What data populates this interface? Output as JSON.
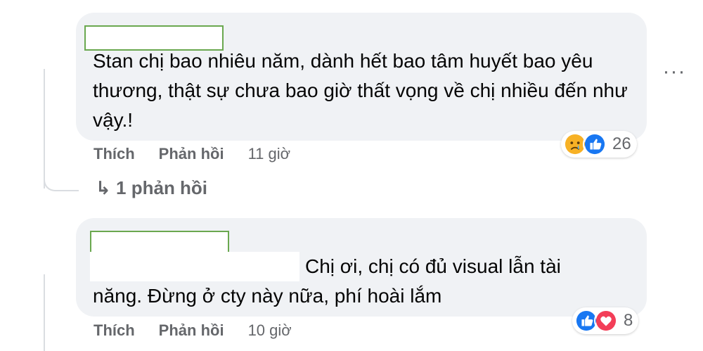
{
  "comments": [
    {
      "text": "Stan chị bao nhiêu năm, dành hết bao tâm huyết bao yêu thương, thật sự chưa bao giờ thất vọng về chị nhiều đến như vậy.!",
      "like_label": "Thích",
      "reply_label": "Phản hồi",
      "time": "11 giờ",
      "reactions": {
        "icons": [
          "sad-icon",
          "like-icon"
        ],
        "count": "26"
      },
      "replies_link": "1 phản hồi"
    },
    {
      "text_line1": "Chị ơi, chị có đủ visual lẫn tài",
      "text_line2": "năng. Đừng ở cty này nữa, phí hoài lắm",
      "like_label": "Thích",
      "reply_label": "Phản hồi",
      "time": "10 giờ",
      "reactions": {
        "icons": [
          "like-icon",
          "love-icon"
        ],
        "count": "8"
      }
    }
  ],
  "more_label": "···",
  "reply_arrow": "↳",
  "colors": {
    "bubble": "#f0f2f5",
    "secondary_text": "#65676b",
    "like_blue": "#1877f2",
    "love_red": "#f33e58",
    "sad_yellow": "#f7b125",
    "name_box_border": "#6aa84f"
  }
}
